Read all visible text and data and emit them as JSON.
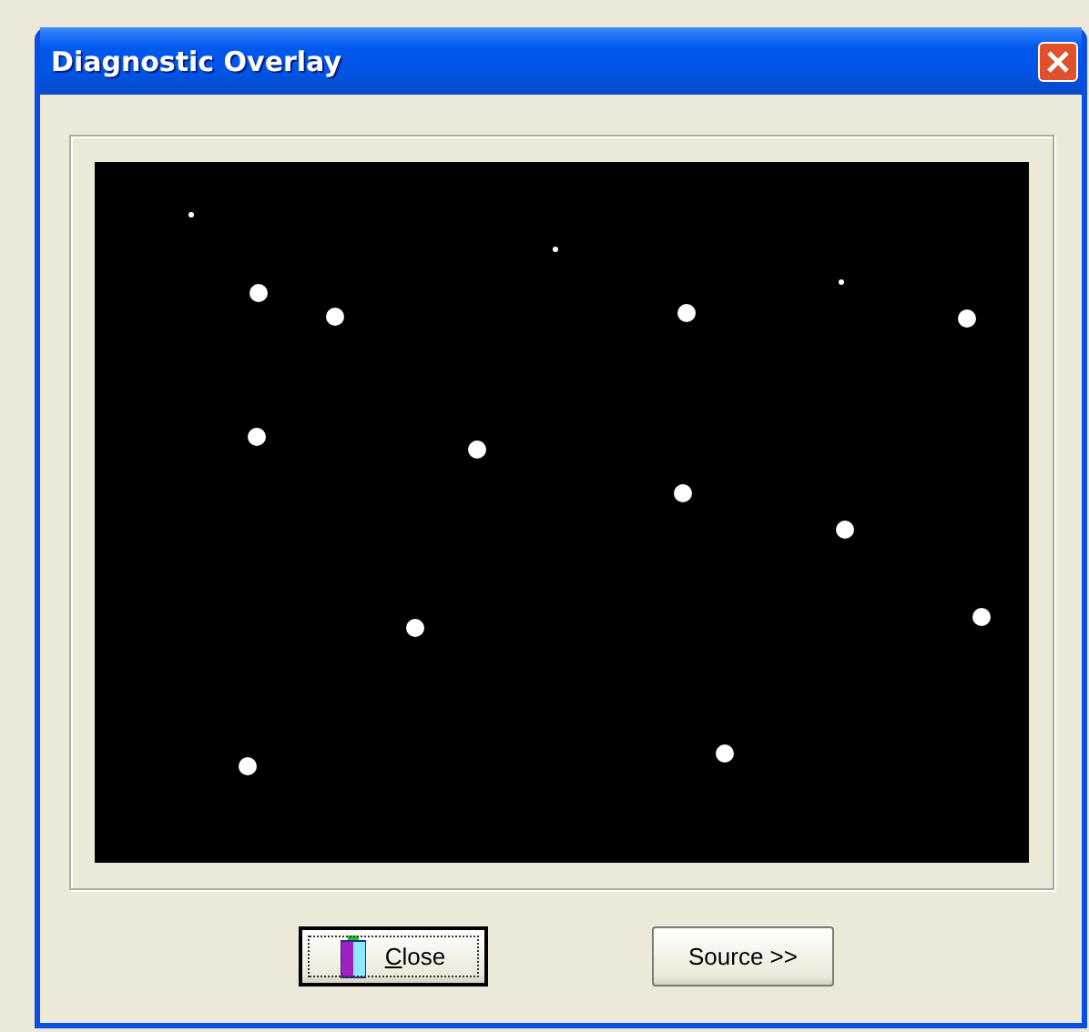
{
  "window": {
    "title": "Diagnostic Overlay"
  },
  "buttons": [
    {
      "label": "Close",
      "kind": "icon",
      "focused": true
    },
    {
      "label": "Source >>",
      "kind": "plain",
      "focused": false
    }
  ]
}
